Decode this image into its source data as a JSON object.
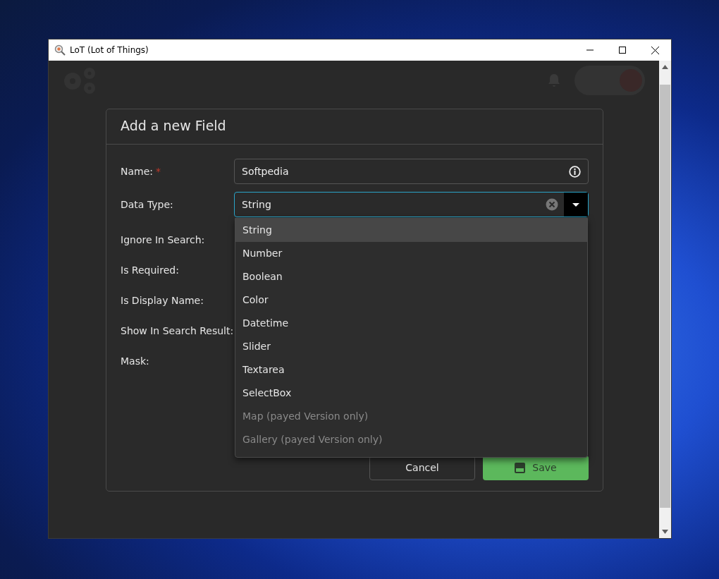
{
  "window": {
    "title": "LoT (Lot of Things)"
  },
  "toggle": {
    "on": true
  },
  "dialog": {
    "title": "Add a new Field",
    "required_mark": "*",
    "fields": [
      {
        "kind": "text",
        "label": "Name:",
        "required": true,
        "value": "Softpedia"
      },
      {
        "kind": "select",
        "label": "Data Type:",
        "required": false,
        "value": "String",
        "expanded": true
      },
      {
        "kind": "label",
        "label": "Ignore In Search:",
        "required": false
      },
      {
        "kind": "label",
        "label": "Is Required:",
        "required": false
      },
      {
        "kind": "label",
        "label": "Is Display Name:",
        "required": false
      },
      {
        "kind": "label",
        "label": "Show In Search Result:",
        "required": false
      },
      {
        "kind": "label",
        "label": "Mask:",
        "required": false
      }
    ],
    "options": [
      {
        "label": "String",
        "selected": true,
        "disabled": false
      },
      {
        "label": "Number",
        "selected": false,
        "disabled": false
      },
      {
        "label": "Boolean",
        "selected": false,
        "disabled": false
      },
      {
        "label": "Color",
        "selected": false,
        "disabled": false
      },
      {
        "label": "Datetime",
        "selected": false,
        "disabled": false
      },
      {
        "label": "Slider",
        "selected": false,
        "disabled": false
      },
      {
        "label": "Textarea",
        "selected": false,
        "disabled": false
      },
      {
        "label": "SelectBox",
        "selected": false,
        "disabled": false
      },
      {
        "label": "Map (payed Version only)",
        "selected": false,
        "disabled": true
      },
      {
        "label": "Gallery (payed Version only)",
        "selected": false,
        "disabled": true
      }
    ],
    "buttons": [
      {
        "kind": "cancel",
        "label": "Cancel"
      },
      {
        "kind": "save",
        "label": "Save"
      }
    ]
  }
}
